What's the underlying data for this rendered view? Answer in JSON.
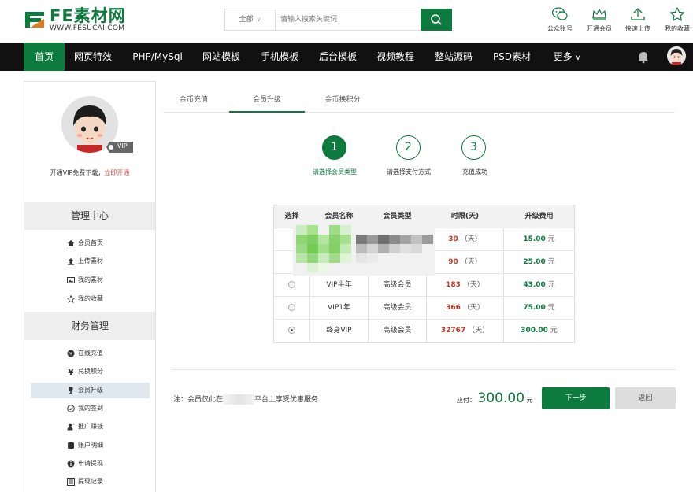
{
  "header": {
    "logo_text": "FE素材网",
    "logo_url_text": "WWW.FESUCAI.COM",
    "search": {
      "category": "全部",
      "placeholder": "请输入搜索关键词"
    },
    "quick_links": [
      {
        "label": "公众账号",
        "icon": "wechat-icon"
      },
      {
        "label": "开通会员",
        "icon": "crown-icon"
      },
      {
        "label": "快速上传",
        "icon": "upload-icon"
      },
      {
        "label": "我的收藏",
        "icon": "star-icon"
      }
    ]
  },
  "nav": {
    "items": [
      "首页",
      "网页特效",
      "PHP/MySql",
      "网站模板",
      "手机模板",
      "后台模板",
      "视频教程",
      "整站源码",
      "PSD素材",
      "更多"
    ],
    "active": "首页"
  },
  "sidebar": {
    "vip_badge": "VIP",
    "promo_text": "开通VIP免费下载，",
    "promo_link": "立即开通",
    "sections": [
      {
        "title": "管理中心",
        "items": [
          "会员首页",
          "上传素材",
          "我的素材",
          "我的收藏"
        ]
      },
      {
        "title": "财务管理",
        "items": [
          "在线充值",
          "兑换积分",
          "会员升级",
          "我的签到",
          "推广赚钱",
          "账户明细",
          "申请提现",
          "提现记录"
        ]
      }
    ],
    "active_item": "会员升级"
  },
  "tabs": [
    "金币充值",
    "会员升级",
    "金币换积分"
  ],
  "active_tab": "会员升级",
  "steps": [
    {
      "num": "1",
      "label": "请选择会员类型"
    },
    {
      "num": "2",
      "label": "请选择支付方式"
    },
    {
      "num": "3",
      "label": "充值成功"
    }
  ],
  "plan_table": {
    "headers": [
      "选择",
      "会员名称",
      "会员类型",
      "时限(天)",
      "升级费用"
    ],
    "rows": [
      {
        "name": "",
        "type": "",
        "days": "30",
        "day_unit": "（天）",
        "price": "15.00",
        "currency": "元",
        "selected": false
      },
      {
        "name": "",
        "type": "",
        "days": "90",
        "day_unit": "（天）",
        "price": "25.00",
        "currency": "元",
        "selected": false
      },
      {
        "name": "VIP半年",
        "type": "高级会员",
        "days": "183",
        "day_unit": "（天）",
        "price": "43.00",
        "currency": "元",
        "selected": false
      },
      {
        "name": "VIP1年",
        "type": "高级会员",
        "days": "366",
        "day_unit": "（天）",
        "price": "75.00",
        "currency": "元",
        "selected": false
      },
      {
        "name": "终身VIP",
        "type": "高级会员",
        "days": "32767",
        "day_unit": "（天）",
        "price": "300.00",
        "currency": "元",
        "selected": true
      }
    ]
  },
  "footer": {
    "note_prefix": "注：会员仅此在",
    "note_suffix": "平台上享受优惠服务",
    "due_label": "应付：",
    "due_amount": "300.00",
    "due_currency": "元",
    "next_button": "下一步",
    "back_button": "返回"
  },
  "colors": {
    "brand": "#0d7a3e",
    "nav_bg": "#111111",
    "days": "#c0392b"
  }
}
